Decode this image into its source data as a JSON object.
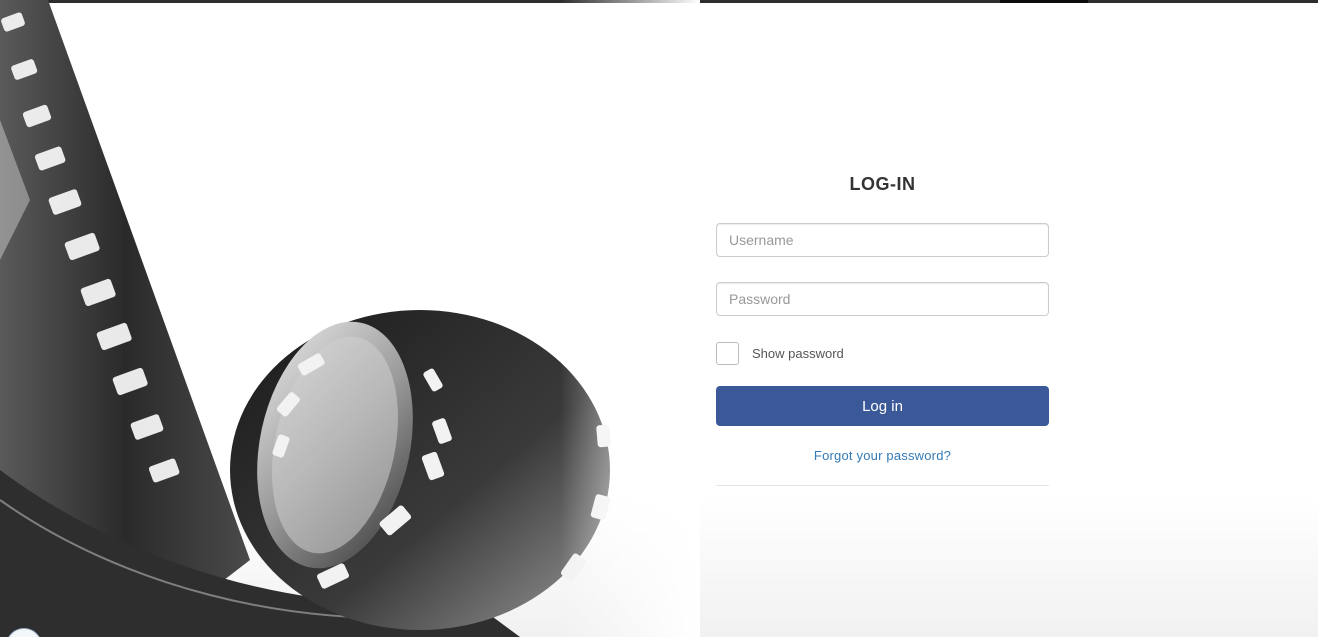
{
  "login": {
    "title": "LOG-IN",
    "username_placeholder": "Username",
    "password_placeholder": "Password",
    "show_password_label": "Show password",
    "submit_label": "Log in",
    "forgot_password_label": "Forgot your password?"
  },
  "theme": {
    "button_color": "#3b5998",
    "link_color": "#337ab7"
  },
  "background": {
    "image": "film-reel-illustration"
  }
}
